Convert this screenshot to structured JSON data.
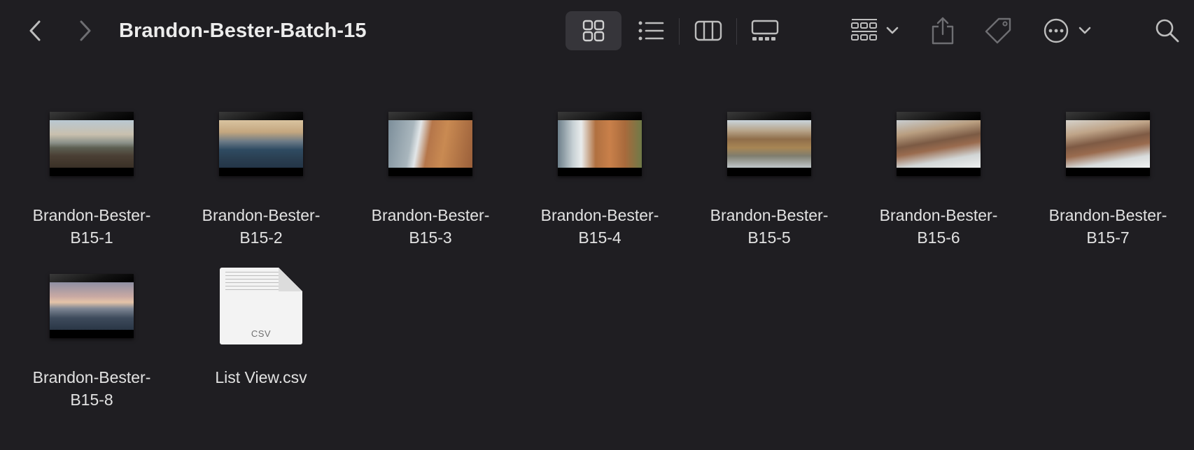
{
  "window": {
    "title": "Brandon-Bester-Batch-15"
  },
  "toolbar": {
    "icons": {
      "back": "chevron-left-icon",
      "forward": "chevron-right-icon",
      "icon_view": "grid-icon",
      "list_view": "list-icon",
      "column_view": "columns-icon",
      "gallery_view": "gallery-icon",
      "group": "group-icon",
      "share": "share-icon",
      "tag": "tag-icon",
      "more": "ellipsis-circle-icon",
      "search": "magnifier-icon"
    },
    "active_view": "icon"
  },
  "files": [
    {
      "name_line1": "Brandon-Bester-",
      "name_line2": "B15-1",
      "kind": "video"
    },
    {
      "name_line1": "Brandon-Bester-",
      "name_line2": "B15-2",
      "kind": "video"
    },
    {
      "name_line1": "Brandon-Bester-",
      "name_line2": "B15-3",
      "kind": "video"
    },
    {
      "name_line1": "Brandon-Bester-",
      "name_line2": "B15-4",
      "kind": "video"
    },
    {
      "name_line1": "Brandon-Bester-",
      "name_line2": "B15-5",
      "kind": "video"
    },
    {
      "name_line1": "Brandon-Bester-",
      "name_line2": "B15-6",
      "kind": "video"
    },
    {
      "name_line1": "Brandon-Bester-",
      "name_line2": "B15-7",
      "kind": "video"
    },
    {
      "name_line1": "Brandon-Bester-",
      "name_line2": "B15-8",
      "kind": "video"
    },
    {
      "name_line1": "List View.csv",
      "name_line2": "",
      "kind": "csv",
      "badge": "CSV"
    }
  ],
  "colors": {
    "background": "#1f1e22",
    "text": "#e2e2e2",
    "icon": "#bdbdbd",
    "icon_dim": "#6e6e72",
    "active_view_bg": "#36353a"
  }
}
